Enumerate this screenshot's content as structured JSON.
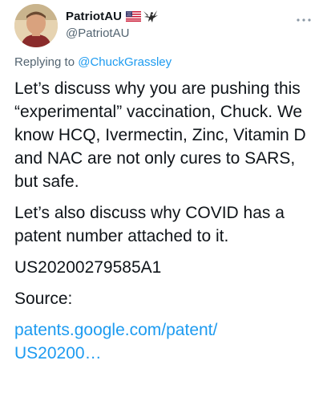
{
  "author": {
    "display_name": "PatriotAU",
    "handle": "@PatriotAU",
    "badges": [
      "us-flag-icon",
      "eagle-icon"
    ]
  },
  "reply": {
    "prefix": "Replying to ",
    "mention": "@ChuckGrassley"
  },
  "body": {
    "paragraphs": [
      "Let’s discuss why you are pushing this “experimental” vaccination, Chuck. We know HCQ, Ivermectin, Zinc, Vitamin D and NAC are not only cures to SARS, but safe.",
      "Let’s also discuss why COVID has a patent number attached to it.",
      "US20200279585A1",
      "Source:"
    ],
    "link_line1": "patents.google.com/patent/",
    "link_line2": "US20200…"
  },
  "icons": {
    "more": "more-horizontal-icon"
  },
  "colors": {
    "text": "#0f1419",
    "secondary": "#536471",
    "accent": "#1d9bf0"
  }
}
